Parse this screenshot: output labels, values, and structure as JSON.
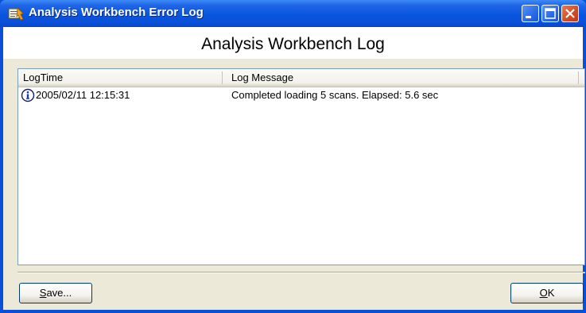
{
  "window": {
    "title": "Analysis Workbench Error Log"
  },
  "header": {
    "heading": "Analysis Workbench Log"
  },
  "log_table": {
    "columns": [
      "LogTime",
      "Log Message"
    ],
    "rows": [
      {
        "icon": "info-icon",
        "log_time": "2005/02/11 12:15:31",
        "message": "Completed loading 5 scans.  Elapsed: 5.6 sec"
      }
    ]
  },
  "buttons": {
    "save_mnemonic": "S",
    "save_rest": "ave...",
    "ok_mnemonic": "O",
    "ok_rest": "K"
  },
  "colors": {
    "titlebar": "#0a4fd8",
    "dialog_background": "#ece9d8",
    "close_button": "#d24a22"
  }
}
